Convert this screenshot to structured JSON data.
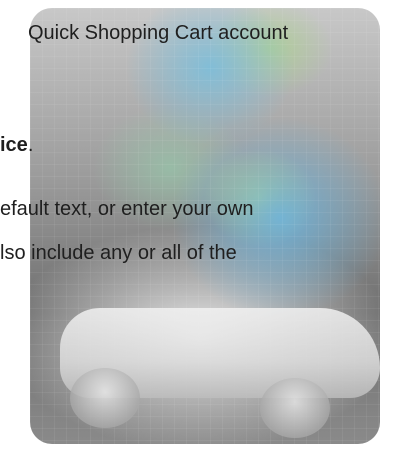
{
  "text": {
    "line1": "Quick Shopping Cart account",
    "line2_bold": "ice",
    "line2_rest": ".",
    "line3": "efault text, or enter your own",
    "line4": "lso include any or all of the"
  }
}
